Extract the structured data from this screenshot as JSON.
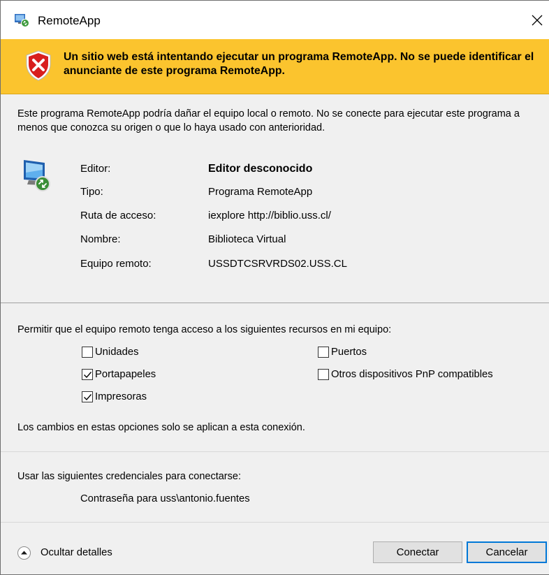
{
  "window": {
    "title": "RemoteApp",
    "close_icon": "close-icon",
    "app_icon": "remoteapp-icon"
  },
  "banner": {
    "background": "#fbc42e",
    "icon": "security-shield-error-icon",
    "message": "Un sitio web está intentando ejecutar un programa RemoteApp. No se puede identificar el anunciante de este programa RemoteApp."
  },
  "warning": "Este programa RemoteApp podría dañar el equipo local o remoto. No se conecte para ejecutar este programa a menos que conozca su origen o que lo haya usado con anterioridad.",
  "info": {
    "icon": "remote-computer-icon",
    "rows": [
      {
        "label": "Editor:",
        "value": "Editor desconocido"
      },
      {
        "label": "Tipo:",
        "value": "Programa RemoteApp"
      },
      {
        "label": "Ruta de acceso:",
        "value": "iexplore http://biblio.uss.cl/"
      },
      {
        "label": "Nombre:",
        "value": "Biblioteca Virtual"
      },
      {
        "label": "Equipo remoto:",
        "value": "USSDTCSRVRDS02.USS.CL"
      }
    ]
  },
  "permissions": {
    "heading": "Permitir que el equipo remoto tenga acceso a los siguientes recursos en mi equipo:",
    "options": [
      {
        "label": "Unidades",
        "checked": false
      },
      {
        "label": "Portapapeles",
        "checked": true
      },
      {
        "label": "Impresoras",
        "checked": true
      },
      {
        "label": "Puertos",
        "checked": false
      },
      {
        "label": "Otros dispositivos PnP compatibles",
        "checked": false
      }
    ],
    "note": "Los cambios en estas opciones solo se aplican a esta conexión."
  },
  "credentials": {
    "heading": "Usar las siguientes credenciales para conectarse:",
    "value": "Contraseña para uss\\antonio.fuentes"
  },
  "footer": {
    "toggle_label": "Ocultar detalles",
    "toggle_icon": "chevron-up-icon",
    "connect_label": "Conectar",
    "cancel_label": "Cancelar",
    "accent": "#0078d7"
  }
}
